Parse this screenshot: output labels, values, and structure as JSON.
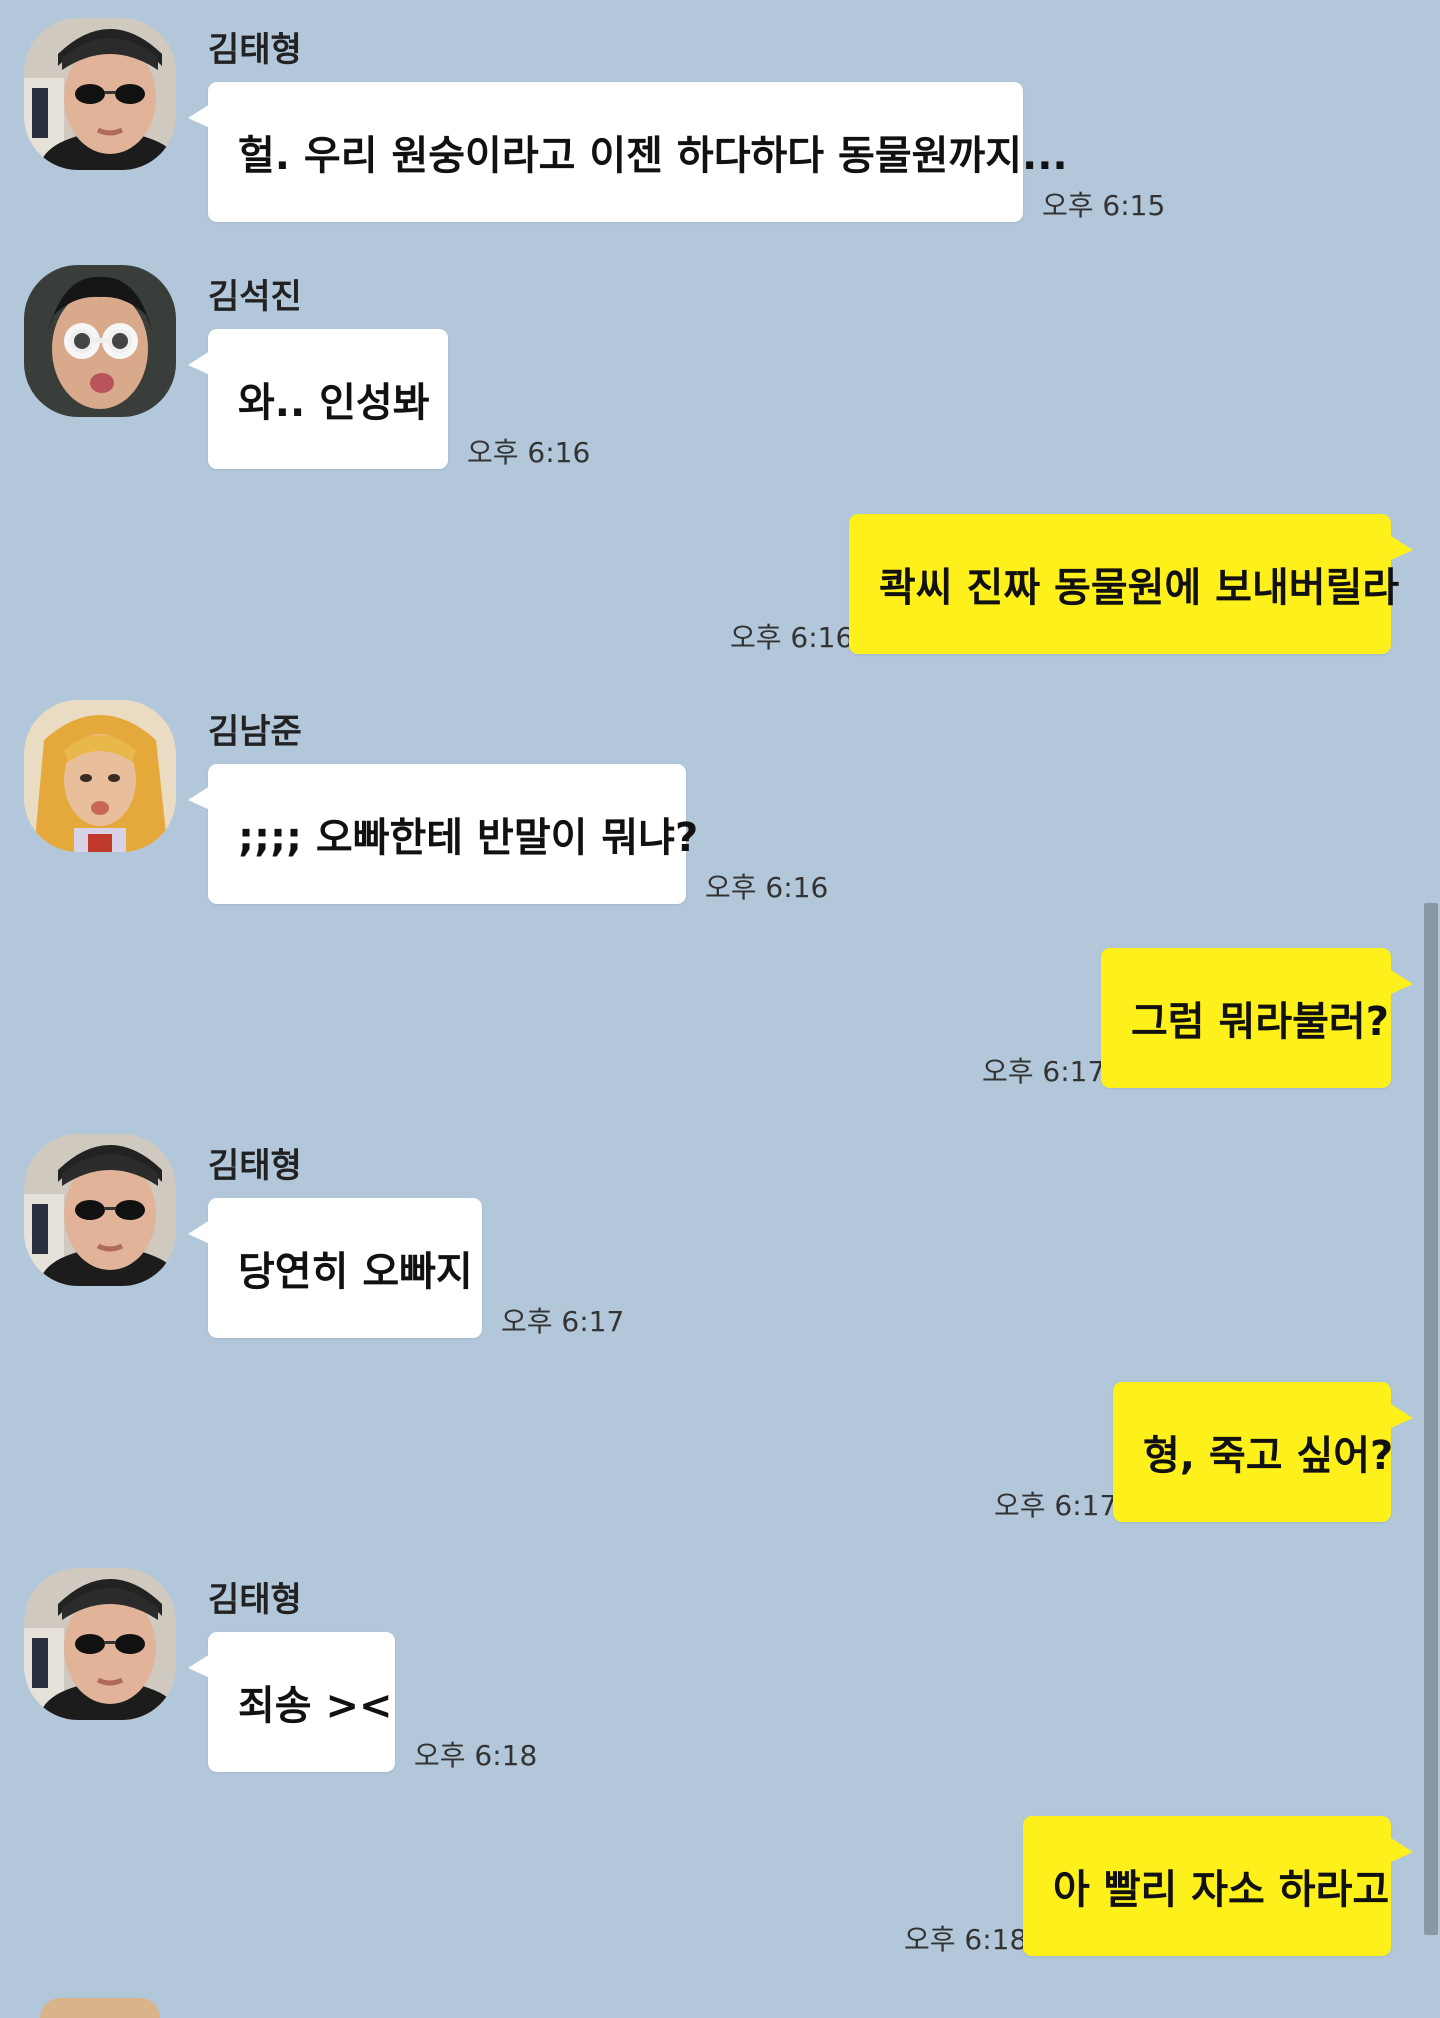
{
  "chat": {
    "messages": [
      {
        "sender": "김태형",
        "text": "헐. 우리 원숭이라고 이젠 하다하다 동물원까지...",
        "time": "오후 6:15"
      },
      {
        "sender": "김석진",
        "text": "와.. 인성봐",
        "time": "오후 6:16"
      },
      {
        "text": "콱씨 진짜 동물원에 보내버릴라",
        "time": "오후 6:16"
      },
      {
        "sender": "김남준",
        "text": ";;;; 오빠한테 반말이 뭐냐?",
        "time": "오후 6:16"
      },
      {
        "text": "그럼 뭐라불러?",
        "time": "오후 6:17"
      },
      {
        "sender": "김태형",
        "text": "당연히 오빠지",
        "time": "오후 6:17"
      },
      {
        "text": "형, 죽고 싶어?",
        "time": "오후 6:17"
      },
      {
        "sender": "김태형",
        "text": "죄송 ><",
        "time": "오후 6:18"
      },
      {
        "text": "아 빨리 자소 하라고",
        "time": "오후 6:18"
      }
    ]
  },
  "colors": {
    "background": "#b2c7da",
    "incoming_bubble": "#ffffff",
    "outgoing_bubble": "#fef01b"
  },
  "icons": {
    "avatar_taehyung": "avatar-taehyung",
    "avatar_seokjin": "avatar-seokjin",
    "avatar_namjoon": "avatar-namjoon"
  }
}
